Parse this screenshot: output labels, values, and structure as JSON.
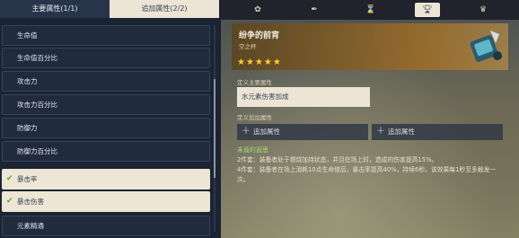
{
  "tabs": {
    "main": "主要属性(1/1)",
    "sub": "追加属性(2/2)"
  },
  "stat_list": [
    {
      "label": "生命值",
      "checked": false
    },
    {
      "label": "生命值百分比",
      "checked": false
    },
    {
      "label": "攻击力",
      "checked": false
    },
    {
      "label": "攻击力百分比",
      "checked": false
    },
    {
      "label": "防御力",
      "checked": false
    },
    {
      "label": "防御力百分比",
      "checked": false
    },
    {
      "label": "暴击率",
      "checked": true
    },
    {
      "label": "暴击伤害",
      "checked": true
    },
    {
      "label": "元素精通",
      "checked": false
    }
  ],
  "nav_icons": [
    "flower-icon",
    "feather-icon",
    "hourglass-icon",
    "goblet-icon",
    "circlet-icon"
  ],
  "nav_selected": 3,
  "artifact": {
    "name": "纷争的前宵",
    "type": "空之杯",
    "stars": "★★★★★"
  },
  "main_stat": {
    "label": "定义主要属性",
    "value": "水元素伤害加成"
  },
  "sub_stats": {
    "label": "定义追加属性",
    "slots": [
      "追加属性",
      "追加属性"
    ]
  },
  "set": {
    "name": "未竟的遐思",
    "two_piece": "2件套：装备者处于燃烧加持状态，并且在场上时，造成的伤害提高15%。",
    "four_piece": "4件套：装备者在场上消耗10点生命值后，暴击率提高40%，持续6秒。该效果每1秒至多触发一次。"
  },
  "colors": {
    "accent_cream": "#ece5d6",
    "check_green": "#5aa13a",
    "star_gold": "#ffcc33",
    "set_green": "#a9d86e"
  }
}
